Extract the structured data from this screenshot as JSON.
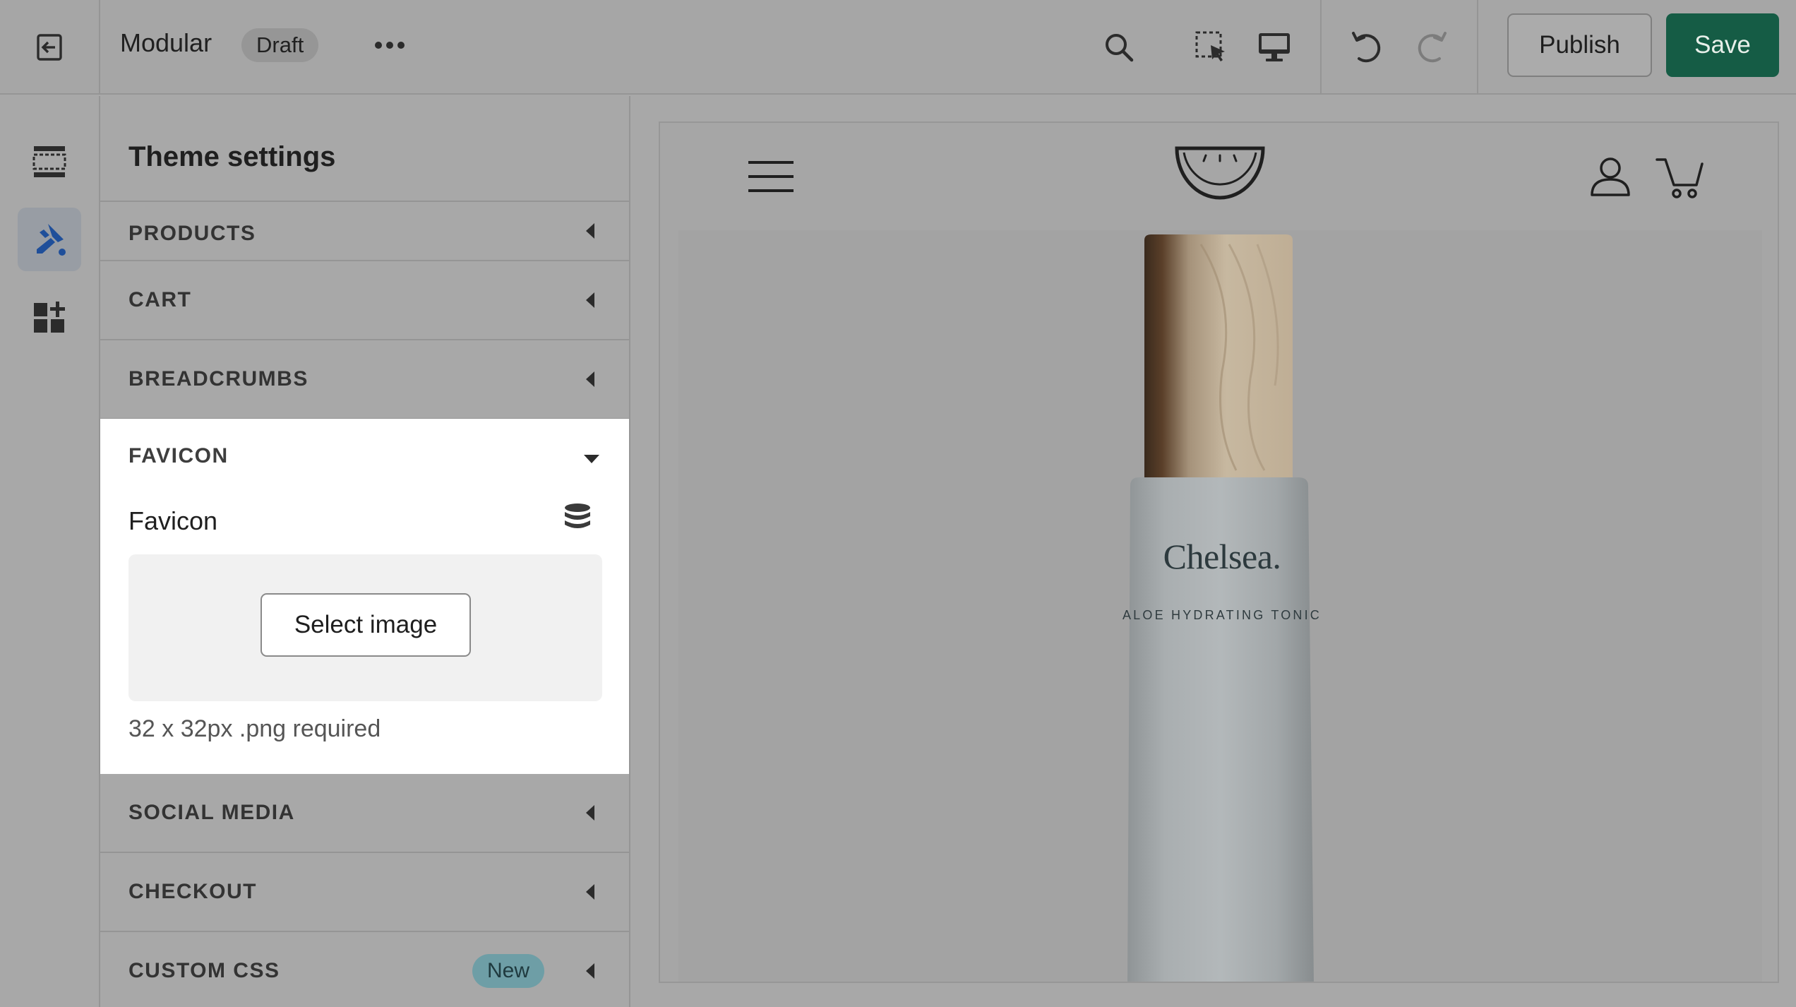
{
  "topbar": {
    "theme_name": "Modular",
    "status_badge": "Draft",
    "icons": [
      "exit-icon",
      "more-icon",
      "search-icon",
      "inspect-icon",
      "desktop-icon",
      "undo-icon",
      "redo-icon"
    ],
    "publish_label": "Publish",
    "save_label": "Save",
    "save_color": "#155c45"
  },
  "rail": {
    "items": [
      {
        "icon": "sections-icon",
        "active": false
      },
      {
        "icon": "theme-settings-icon",
        "active": true
      },
      {
        "icon": "app-blocks-icon",
        "active": false
      }
    ],
    "active_color": "#1f4f9a"
  },
  "panel": {
    "title": "Theme settings",
    "sections_above": [
      {
        "label": "PRODUCTS"
      },
      {
        "label": "CART"
      },
      {
        "label": "BREADCRUMBS"
      }
    ],
    "favicon": {
      "label": "FAVICON",
      "field_label": "Favicon",
      "field_icon": "database-icon",
      "button_label": "Select image",
      "help_text": "32 x 32px .png required"
    },
    "sections_below": [
      {
        "label": "SOCIAL MEDIA"
      },
      {
        "label": "CHECKOUT"
      },
      {
        "label": "CUSTOM CSS",
        "badge": "New"
      }
    ]
  },
  "preview": {
    "header_icons": [
      "menu-icon",
      "store-logo-icon",
      "account-icon",
      "cart-icon"
    ],
    "product_brand": "Chelsea.",
    "product_name": "ALOE HYDRATING TONIC"
  }
}
